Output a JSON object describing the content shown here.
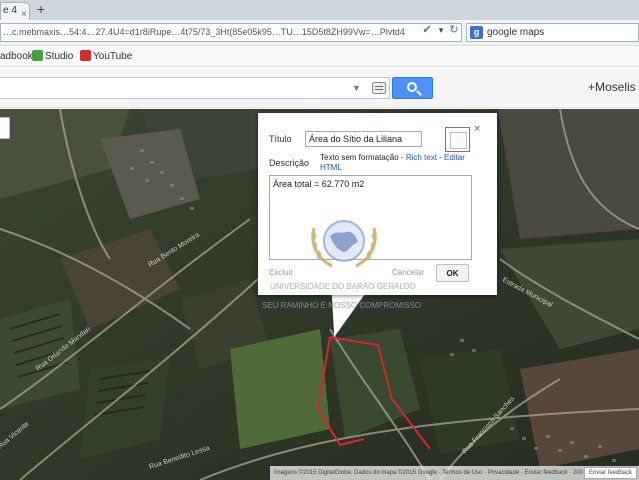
{
  "browser": {
    "tab_label": "e 4",
    "tab_close": "×",
    "new_tab": "+",
    "address": "…c.mebmaxis…54:4…27.4U4=d1r8iRupe…4t75/73_3Ht(85e05k95…TU…15D5t8ZH99Vw=…Plvtd4",
    "search_query": "google maps",
    "search_engine_glyph": "g",
    "bookmarks": [
      {
        "label": "adbook",
        "icon_color": "#3a6fd0"
      },
      {
        "label": "Studio",
        "icon_color": "#4a9a43"
      },
      {
        "label": "YouTube",
        "icon_color": "#d62b2b"
      }
    ]
  },
  "maps": {
    "user_label": "+Moselis"
  },
  "info_window": {
    "title_label": "Título",
    "title_value": "Área do Sítio da Liliana",
    "description_label": "Descrição",
    "format_plain": "Texto sem formatação",
    "format_rich": "Rich text",
    "format_html": "Editar HTML",
    "description_value": "Área total = 62.770 m2",
    "delete_label": "Excluir",
    "cancel_label": "Cancelar",
    "ok_label": "OK",
    "close_glyph": "×"
  },
  "watermark": {
    "line1": "UNIVERSIDADE DO BARÃO GERALDO",
    "line2": "SEU RAMINHO É NOSSO COMPROMISSO"
  },
  "map": {
    "road_labels": [
      "Rua Bento Moreira",
      "Rua Orlando Mandari",
      "Estrada Municipal",
      "Rua Francisco Sanches",
      "Rua Vicente",
      "Rua Benedito Lessa"
    ],
    "footer": "Imagens ©2015 DigitalGlobe, Dados do mapa ©2015 Google · Termos de Uso · Privacidade · Enviar feedback · 200 m",
    "feedback_button": "Enviar feedback"
  },
  "colors": {
    "search_button": "#4d90fe",
    "property_outline": "#d8262b",
    "link": "#1a56c8"
  }
}
